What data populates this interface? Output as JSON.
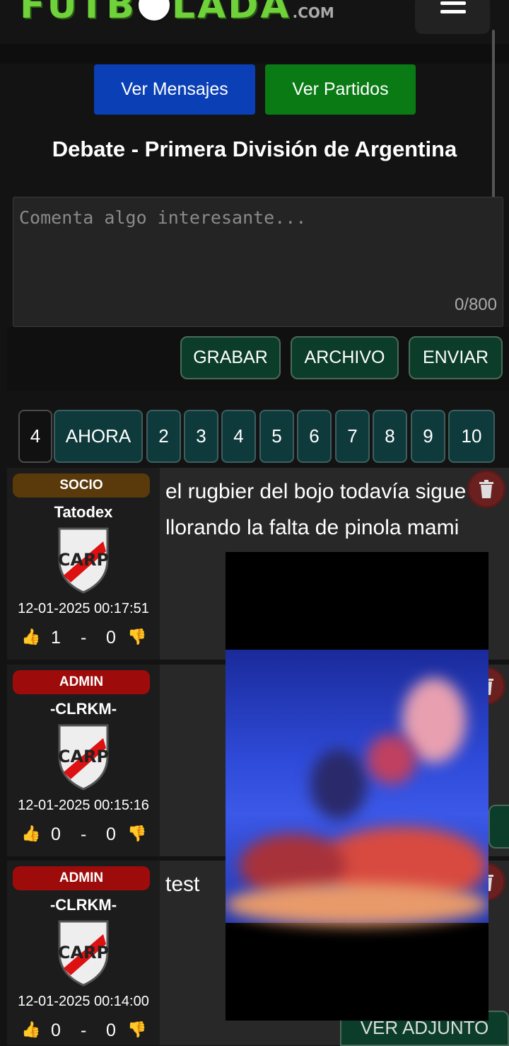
{
  "header": {
    "logo_text": "FUTBOLADA",
    "logo_suffix": ".COM",
    "menu_icon": "hamburger-icon"
  },
  "nav": {
    "messages_label": "Ver Mensajes",
    "matches_label": "Ver Partidos"
  },
  "page": {
    "title": "Debate - Primera División de Argentina"
  },
  "composer": {
    "placeholder": "Comenta algo interesante...",
    "char_count": "0/800",
    "record_label": "GRABAR",
    "file_label": "ARCHIVO",
    "send_label": "ENVIAR"
  },
  "pagination": {
    "current": "4",
    "now_label": "AHORA",
    "pages": [
      "2",
      "3",
      "4",
      "5",
      "6",
      "7",
      "8",
      "9",
      "10"
    ]
  },
  "posts": [
    {
      "role": "SOCIO",
      "role_color": "#5a3a0a",
      "user": "Tatodex",
      "date": "12-01-2025 00:17:51",
      "likes": "1",
      "dislikes": "0",
      "text": "el rugbier del bojo todavía sigue llorando la falta de pinola mami"
    },
    {
      "role": "ADMIN",
      "role_color": "#9e0b0b",
      "user": "-CLRKM-",
      "date": "12-01-2025 00:15:16",
      "likes": "0",
      "dislikes": "0",
      "text": ""
    },
    {
      "role": "ADMIN",
      "role_color": "#9e0b0b",
      "user": "-CLRKM-",
      "date": "12-01-2025 00:14:00",
      "likes": "0",
      "dislikes": "0",
      "text": "test"
    }
  ],
  "attachment": {
    "view_label": "VER ADJUNTO"
  },
  "colors": {
    "messages_button": "#0a3fb5",
    "matches_button": "#0a7a14",
    "logo_green": "#6fd23b",
    "action_button": "#0b3d2a",
    "page_button": "#0f3a3c"
  }
}
